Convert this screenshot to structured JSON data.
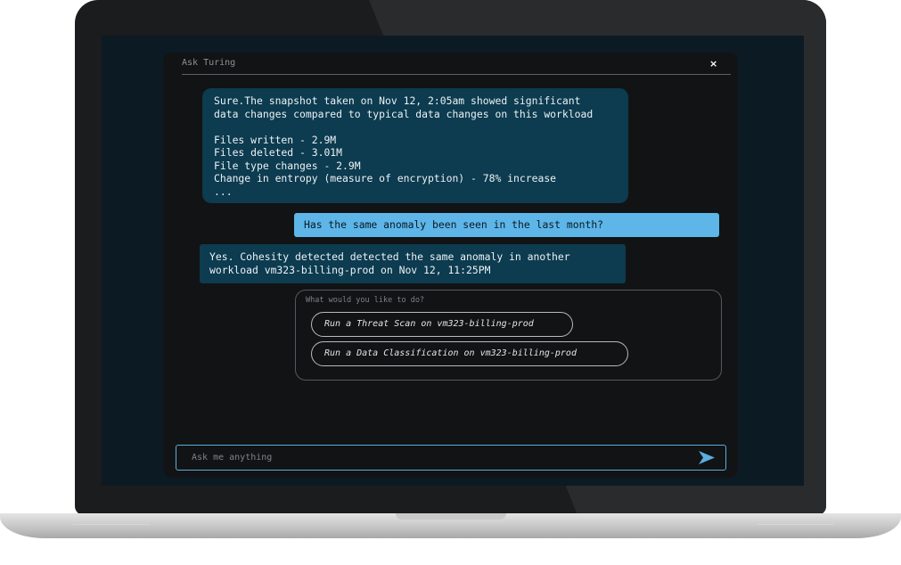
{
  "panel": {
    "title": "Ask Turing",
    "close_icon": "close-icon",
    "close_glyph": "×"
  },
  "messages": [
    {
      "role": "bot",
      "text": "Sure.The snapshot taken on Nov 12, 2:05am showed significant\ndata changes compared to typical data changes on this workload\n\nFiles written - 2.9M\nFiles deleted - 3.01M\nFile type changes - 2.9M\nChange in entropy (measure of encryption) - 78% increase\n..."
    },
    {
      "role": "user",
      "text": "Has the same anomaly been seen in the last month?"
    },
    {
      "role": "bot",
      "text": "Yes. Cohesity detected detected the same anomaly in another\nworkload vm323-billing-prod on Nov 12, 11:25PM"
    }
  ],
  "actions": {
    "prompt": "What would you like to do?",
    "options": [
      "Run a Threat Scan on vm323-billing-prod",
      "Run a Data Classification on vm323-billing-prod"
    ]
  },
  "input": {
    "placeholder": "Ask me anything",
    "value": "",
    "send_icon": "send-arrow-icon"
  },
  "colors": {
    "bot_bubble": "#0d3b4f",
    "user_bubble": "#5db5e8",
    "accent": "#5aaee0",
    "panel_bg": "#121314"
  }
}
